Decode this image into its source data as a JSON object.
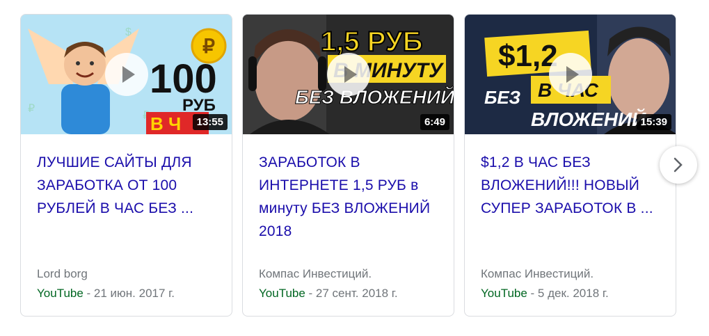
{
  "cards": [
    {
      "title": "ЛУЧШИЕ САЙТЫ ДЛЯ ЗАРАБОТКА ОТ 100 РУБЛЕЙ В ЧАС БЕЗ ...",
      "duration": "13:55",
      "author": "Lord borg",
      "platform": "YouTube",
      "date": " - 21 июн. 2017 г.",
      "thumb_text": [
        "100",
        "РУБ",
        "В Ч"
      ]
    },
    {
      "title": "ЗАРАБОТОК В ИНТЕРНЕТЕ 1,5 РУБ в минуту БЕЗ ВЛОЖЕНИЙ 2018",
      "duration": "6:49",
      "author": "Компас Инвестиций.",
      "platform": "YouTube",
      "date": " - 27 сент. 2018 г.",
      "thumb_text": [
        "1,5 РУБ",
        "В МИНУТУ",
        "БЕЗ ВЛОЖЕНИЙ"
      ]
    },
    {
      "title": "$1,2 В ЧАС БЕЗ ВЛОЖЕНИЙ!!! НОВЫЙ СУПЕР ЗАРАБОТОК В ...",
      "duration": "15:39",
      "author": "Компас Инвестиций.",
      "platform": "YouTube",
      "date": " - 5 дек. 2018 г.",
      "thumb_text": [
        "$1,2",
        "В ЧАС",
        "БЕЗ",
        "ВЛОЖЕНИЙ"
      ]
    }
  ],
  "icons": {
    "play": "play-icon",
    "next": "chevron-right-icon",
    "coin": "ruble-coin-icon"
  },
  "colors": {
    "title_link": "#1a0dab",
    "platform": "#006621",
    "meta": "#70757a",
    "thumb1_bg": "#b6e3f5",
    "thumb_yellow": "#f6d523"
  }
}
